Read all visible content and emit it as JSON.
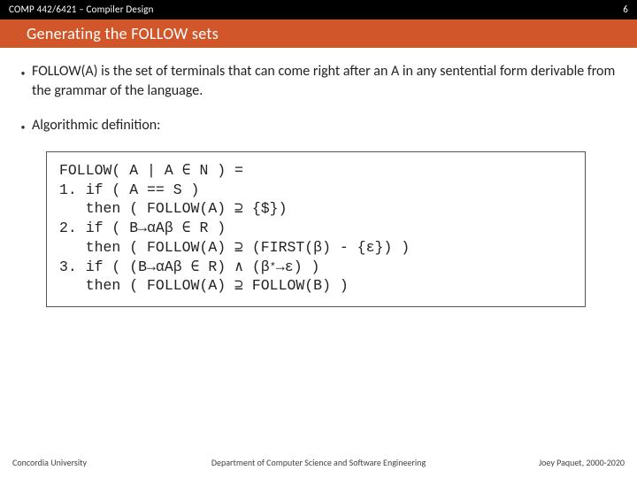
{
  "top": {
    "course": "COMP 442/6421 – Compiler Design",
    "page_number": "6"
  },
  "title": "Generating the FOLLOW sets",
  "bullets": {
    "definition": "FOLLOW(A) is the set of terminals that can come right after an A in any sentential form derivable from the grammar of the language.",
    "algo_intro": "Algorithmic definition:"
  },
  "algorithm": {
    "line1": "FOLLOW( A | A ∈ N ) =",
    "line2": "1. if ( A == S )",
    "line3": "   then ( FOLLOW(A) ⊇ {$})",
    "line4": "2. if ( B→αAβ ∈ R )",
    "line5": "   then ( FOLLOW(A) ⊇ (FIRST(β) - {ε}) )",
    "line6a": "3. if ( (B→αAβ ∈ R) ∧ (β",
    "line6_star": "*",
    "line6b": "→ε) )",
    "line7": "   then ( FOLLOW(A) ⊇ FOLLOW(B) )"
  },
  "footer": {
    "left": "Concordia University",
    "center": "Department of Computer Science and Software Engineering",
    "right": "Joey Paquet, 2000-2020"
  }
}
